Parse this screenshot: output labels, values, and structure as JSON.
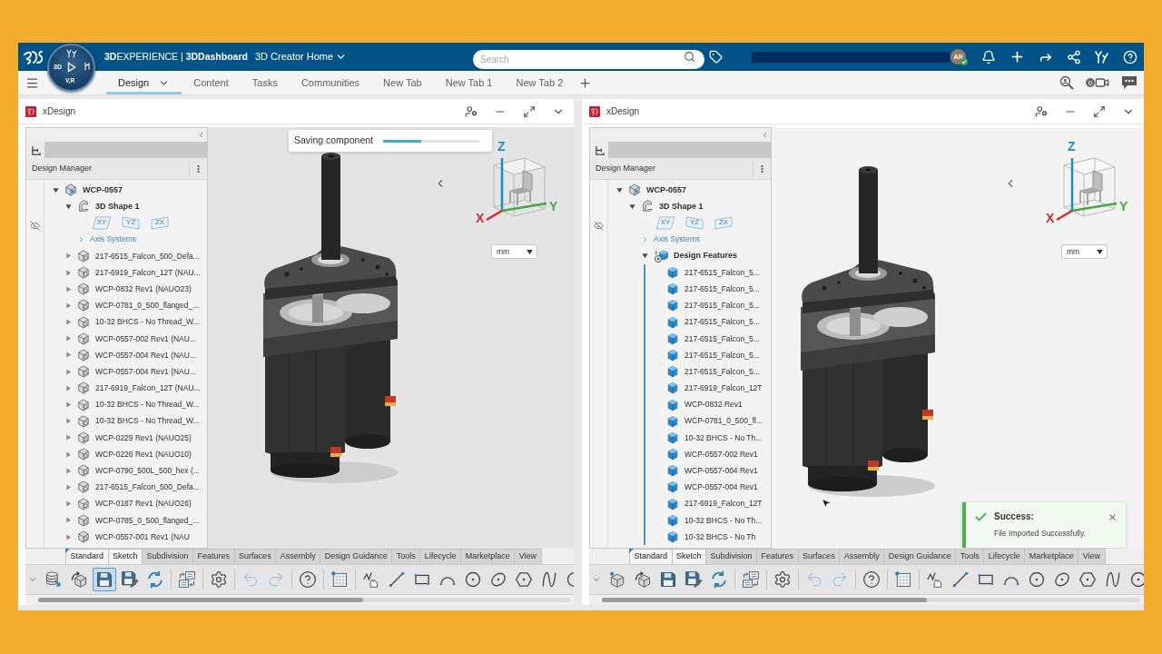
{
  "top_bar": {
    "compass": {
      "left_label": "3D",
      "bottom_label": "V,R"
    },
    "title": "**3D**EXPERIENCE | **3DDashboard**",
    "dashboard": "3D Creator Home",
    "search": {
      "placeholder": "Search"
    },
    "avatar": {
      "initials": "AR",
      "online": true
    }
  },
  "tab_bar": {
    "tabs": [
      {
        "label": "Design",
        "selected": true
      },
      {
        "label": "Content",
        "selected": false
      },
      {
        "label": "Tasks",
        "selected": false
      },
      {
        "label": "Communities",
        "selected": false
      },
      {
        "label": "New Tab",
        "selected": false
      },
      {
        "label": "New Tab 1",
        "selected": false
      },
      {
        "label": "New Tab 2",
        "selected": false
      }
    ],
    "video_count": "0"
  },
  "panels": [
    {
      "app": "xDesign",
      "tree": {
        "title": "Design Manager",
        "items": [
          {
            "kind": "product",
            "label": "WCP-0557",
            "expanded": true,
            "children": [
              {
                "kind": "shape",
                "label": "3D Shape 1",
                "expanded": true,
                "children": [
                  {
                    "kind": "planes",
                    "labels": [
                      "XY",
                      "YZ",
                      "ZX"
                    ]
                  },
                  {
                    "kind": "axis_systems",
                    "label": "Axis Systems",
                    "expanded": false
                  }
                ]
              },
              {
                "kind": "assembly",
                "label": "217-6515_Falcon_500_Defa...",
                "expanded": false
              },
              {
                "kind": "assembly",
                "label": "217-6919_Falcon_12T (NAU...",
                "expanded": false
              },
              {
                "kind": "assembly",
                "label": "WCP-0832 Rev1 (NAUO23)",
                "expanded": false
              },
              {
                "kind": "assembly",
                "label": "WCP-0781_0_500_flanged_...",
                "expanded": false
              },
              {
                "kind": "assembly",
                "label": "10-32 BHCS - No Thread_W...",
                "expanded": false
              },
              {
                "kind": "assembly",
                "label": "WCP-0557-002 Rev1 (NAU...",
                "expanded": false
              },
              {
                "kind": "assembly",
                "label": "WCP-0557-004 Rev1 (NAU...",
                "expanded": false
              },
              {
                "kind": "assembly",
                "label": "WCP-0557-004 Rev1 (NAU...",
                "expanded": false
              },
              {
                "kind": "assembly",
                "label": "217-6919_Falcon_12T (NAU...",
                "expanded": false
              },
              {
                "kind": "assembly",
                "label": "10-32 BHCS - No Thread_W...",
                "expanded": false
              },
              {
                "kind": "assembly",
                "label": "10-32 BHCS - No Thread_W...",
                "expanded": false
              },
              {
                "kind": "assembly",
                "label": "WCP-0229 Rev1 (NAUO25)",
                "expanded": false
              },
              {
                "kind": "assembly",
                "label": "WCP-0226 Rev1 (NAUO10)",
                "expanded": false
              },
              {
                "kind": "assembly",
                "label": "WCP-0790_500L_500_hex (...",
                "expanded": false
              },
              {
                "kind": "assembly",
                "label": "217-6515_Falcon_500_Defa...",
                "expanded": false
              },
              {
                "kind": "assembly",
                "label": "WCP-0187 Rev1 (NAUO26)",
                "expanded": false
              },
              {
                "kind": "assembly",
                "label": "WCP-0785_0_500_flanged_...",
                "expanded": false
              },
              {
                "kind": "assembly",
                "label": "WCP-0557-001 Rev1 (NAU",
                "expanded": false
              }
            ]
          }
        ]
      },
      "saving": {
        "label": "Saving component",
        "level": 0.4
      },
      "view_cube": {
        "axes": [
          {
            "label": "Z",
            "color": "#1d8fc7"
          },
          {
            "label": "X",
            "color": "#d7282f"
          },
          {
            "label": "Y",
            "color": "#43a943"
          }
        ]
      },
      "units": "mm",
      "toolbar": {
        "tabs": [
          {
            "label": "Standard",
            "selected": true
          },
          {
            "label": "Sketch",
            "selected": true
          },
          {
            "label": "Subdivision",
            "selected": false
          },
          {
            "label": "Features",
            "selected": false
          },
          {
            "label": "Surfaces",
            "selected": false
          },
          {
            "label": "Assembly",
            "selected": false
          },
          {
            "label": "Design Guidance",
            "selected": false
          },
          {
            "label": "Tools",
            "selected": false
          },
          {
            "label": "Lifecycle",
            "selected": false
          },
          {
            "label": "Marketplace",
            "selected": false
          },
          {
            "label": "View",
            "selected": false
          }
        ],
        "tool_groups": [
          {
            "tools": [
              {
                "kind": "open",
                "pressed": false,
                "disabled": false
              },
              {
                "kind": "import",
                "pressed": false,
                "disabled": false
              },
              {
                "kind": "save",
                "pressed": true,
                "disabled": false
              },
              {
                "kind": "save_as",
                "pressed": false,
                "disabled": false
              },
              {
                "kind": "refresh",
                "pressed": false,
                "disabled": false
              }
            ]
          },
          {
            "tools": [
              {
                "kind": "compare",
                "pressed": false,
                "disabled": false
              }
            ]
          },
          {
            "tools": [
              {
                "kind": "options",
                "pressed": false,
                "disabled": false
              }
            ]
          },
          {
            "tools": [
              {
                "kind": "undo",
                "pressed": false,
                "disabled": true
              },
              {
                "kind": "redo",
                "pressed": false,
                "disabled": true
              }
            ]
          },
          {
            "tools": [
              {
                "kind": "help",
                "pressed": false,
                "disabled": false
              }
            ]
          },
          {
            "tools": [
              {
                "kind": "sketch",
                "pressed": false,
                "disabled": false
              }
            ]
          },
          {
            "tools": [
              {
                "kind": "freehand",
                "pressed": false,
                "disabled": false
              },
              {
                "kind": "line",
                "pressed": false,
                "disabled": false
              },
              {
                "kind": "rectangle",
                "pressed": false,
                "disabled": false
              },
              {
                "kind": "arc",
                "pressed": false,
                "disabled": false
              },
              {
                "kind": "circle",
                "pressed": false,
                "disabled": false
              },
              {
                "kind": "ellipse",
                "pressed": false,
                "disabled": false
              },
              {
                "kind": "polygon",
                "pressed": false,
                "disabled": false
              },
              {
                "kind": "spline",
                "pressed": false,
                "disabled": false
              },
              {
                "kind": "point",
                "pressed": false,
                "disabled": false
              }
            ]
          }
        ]
      }
    },
    {
      "app": "xDesign",
      "tree": {
        "title": "Design Manager",
        "items": [
          {
            "kind": "product",
            "label": "WCP-0557",
            "expanded": true,
            "children": [
              {
                "kind": "shape",
                "label": "3D Shape 1",
                "expanded": true,
                "children": [
                  {
                    "kind": "planes",
                    "labels": [
                      "XY",
                      "YZ",
                      "ZX"
                    ]
                  },
                  {
                    "kind": "axis_systems",
                    "label": "Axis Systems",
                    "expanded": false
                  },
                  {
                    "kind": "features",
                    "label": "Design Features",
                    "expanded": true,
                    "children": [
                      {
                        "kind": "part",
                        "label": "217-6515_Falcon_5..."
                      },
                      {
                        "kind": "part",
                        "label": "217-6515_Falcon_5..."
                      },
                      {
                        "kind": "part",
                        "label": "217-6515_Falcon_5..."
                      },
                      {
                        "kind": "part",
                        "label": "217-6515_Falcon_5..."
                      },
                      {
                        "kind": "part",
                        "label": "217-6515_Falcon_5..."
                      },
                      {
                        "kind": "part",
                        "label": "217-6515_Falcon_5..."
                      },
                      {
                        "kind": "part",
                        "label": "217-6515_Falcon_5..."
                      },
                      {
                        "kind": "part",
                        "label": "217-6919_Falcon_12T"
                      },
                      {
                        "kind": "part",
                        "label": "WCP-0832 Rev1"
                      },
                      {
                        "kind": "part",
                        "label": "WCP-0781_0_500_fl..."
                      },
                      {
                        "kind": "part",
                        "label": "10-32 BHCS - No Th..."
                      },
                      {
                        "kind": "part",
                        "label": "WCP-0557-002 Rev1"
                      },
                      {
                        "kind": "part",
                        "label": "WCP-0557-004 Rev1"
                      },
                      {
                        "kind": "part",
                        "label": "WCP-0557-004 Rev1"
                      },
                      {
                        "kind": "part",
                        "label": "217-6919_Falcon_12T"
                      },
                      {
                        "kind": "part",
                        "label": "10-32 BHCS - No Th..."
                      },
                      {
                        "kind": "part",
                        "label": "10-32 BHCS - No Th"
                      }
                    ]
                  }
                ]
              }
            ]
          }
        ]
      },
      "view_cube": {
        "axes": [
          {
            "label": "Z",
            "color": "#1d8fc7"
          },
          {
            "label": "X",
            "color": "#d7282f"
          },
          {
            "label": "Y",
            "color": "#43a943"
          }
        ]
      },
      "units": "mm",
      "notification": {
        "kind": "success",
        "title": "Success:",
        "message": "File Imported Successfully."
      },
      "toolbar": {
        "tabs": [
          {
            "label": "Standard",
            "selected": true
          },
          {
            "label": "Sketch",
            "selected": true
          },
          {
            "label": "Subdivision",
            "selected": false
          },
          {
            "label": "Features",
            "selected": false
          },
          {
            "label": "Surfaces",
            "selected": false
          },
          {
            "label": "Assembly",
            "selected": false
          },
          {
            "label": "Design Guidance",
            "selected": false
          },
          {
            "label": "Tools",
            "selected": false
          },
          {
            "label": "Lifecycle",
            "selected": false
          },
          {
            "label": "Marketplace",
            "selected": false
          },
          {
            "label": "View",
            "selected": false
          }
        ],
        "tool_groups": [
          {
            "tools": [
              {
                "kind": "new",
                "pressed": false,
                "disabled": false
              },
              {
                "kind": "import",
                "pressed": false,
                "disabled": false
              },
              {
                "kind": "save",
                "pressed": false,
                "disabled": false
              },
              {
                "kind": "save_as",
                "pressed": false,
                "disabled": false
              },
              {
                "kind": "refresh",
                "pressed": false,
                "disabled": false
              }
            ]
          },
          {
            "tools": [
              {
                "kind": "compare",
                "pressed": false,
                "disabled": false
              }
            ]
          },
          {
            "tools": [
              {
                "kind": "options",
                "pressed": false,
                "disabled": false
              }
            ]
          },
          {
            "tools": [
              {
                "kind": "undo",
                "pressed": false,
                "disabled": true
              },
              {
                "kind": "redo",
                "pressed": false,
                "disabled": true
              }
            ]
          },
          {
            "tools": [
              {
                "kind": "help",
                "pressed": false,
                "disabled": false
              }
            ]
          },
          {
            "tools": [
              {
                "kind": "sketch",
                "pressed": false,
                "disabled": false
              }
            ]
          },
          {
            "tools": [
              {
                "kind": "freehand",
                "pressed": false,
                "disabled": false
              },
              {
                "kind": "line",
                "pressed": false,
                "disabled": false
              },
              {
                "kind": "rectangle",
                "pressed": false,
                "disabled": false
              },
              {
                "kind": "arc",
                "pressed": false,
                "disabled": false
              },
              {
                "kind": "circle",
                "pressed": false,
                "disabled": false
              },
              {
                "kind": "ellipse",
                "pressed": false,
                "disabled": false
              },
              {
                "kind": "polygon",
                "pressed": false,
                "disabled": false
              },
              {
                "kind": "spline",
                "pressed": false,
                "disabled": false
              },
              {
                "kind": "point",
                "pressed": false,
                "disabled": false
              }
            ]
          }
        ]
      }
    }
  ]
}
